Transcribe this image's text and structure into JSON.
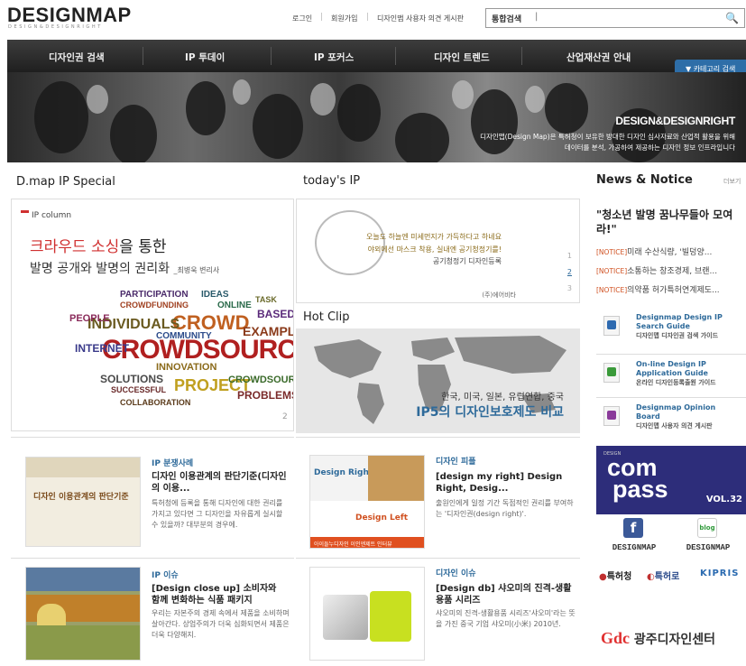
{
  "header": {
    "logo": "DESIGNMAP",
    "logo_sub": "DESIGN&DESIGNRIGHT",
    "links": [
      "로그인",
      "회원가입",
      "디자인맵 사용자 의견 게시판"
    ],
    "search_label": "통합검색",
    "search_caret": "|",
    "search_icon": "search-icon"
  },
  "nav": {
    "items": [
      "디자인권 검색",
      "IP 투데이",
      "IP 포커스",
      "디자인 트렌드",
      "산업재산권 안내"
    ],
    "category_button": "▼ 카테고리 검색"
  },
  "banner": {
    "title": "DESIGN&DESIGNRIGHT",
    "desc1": "디자인맵(Design Map)은 특허청이 보유한 방대한 디자인 심사자료와 산업적 활용을 위해",
    "desc2": "데이터를 분석, 가공하여 제공하는 디자인 정보 인프라입니다"
  },
  "ip_special": {
    "heading": "D.map IP Special",
    "column_label": "IP column",
    "headline_red": "크라우드 소싱",
    "headline_rest": "을 통한",
    "subheadline": "발명 공개와 발명의 권리화",
    "author": "_최병욱 변리사",
    "page": "2",
    "cloud_words": [
      "CROWDSOURCING",
      "CROWD",
      "INDIVIDUALS",
      "INTERNET",
      "PEOPLE",
      "EXAMPLE",
      "BASED",
      "ONLINE",
      "TASK",
      "COMMUNITY",
      "SOLUTIONS",
      "SUCCESSFUL",
      "PROJECT",
      "CROWDSOURCED",
      "COLLABORATION",
      "PROBLEMS",
      "PARTICIPATION",
      "CROWDFUNDING",
      "IDEAS",
      "INNOVATION"
    ]
  },
  "today_ip": {
    "heading": "today's IP",
    "line1": "오늘도 하늘엔 미세먼지가 가득하다고 하네요",
    "line2": "야외에선 마스크 착용, 실내엔 공기청정기를!",
    "line3": "공기청정기 디자인등록",
    "maker": "(주)에어비타",
    "pages": [
      "1",
      "2",
      "3"
    ]
  },
  "hot_clip": {
    "heading": "Hot Clip",
    "line1": "한국, 미국, 일본, 유럽연합, 중국",
    "line2": "IP5의 디자인보호제도 비교"
  },
  "news": {
    "heading": "News & Notice",
    "more": "더보기",
    "title": "\"청소년 발명 꿈나무들아 모여라!\"",
    "items": [
      {
        "tag": "[NOTICE]",
        "text": "미래 수산식량, '빌덩양..."
      },
      {
        "tag": "[NOTICE]",
        "text": "소통하는 창조경제, 브랜..."
      },
      {
        "tag": "[NOTICE]",
        "text": "의약품 허가특허연계제도..."
      }
    ]
  },
  "quick_links": [
    {
      "title": "Designmap Design IP Search Guide",
      "sub": "디자인맵 디자인권 검색 가이드",
      "icon": "search-guide-icon",
      "color": "#2e6ab0"
    },
    {
      "title": "On-line Design IP Application Guide",
      "sub": "온라인 디자인등록출원 가이드",
      "icon": "application-guide-icon",
      "color": "#3a9a3a"
    },
    {
      "title": "Designmap Opinion Board",
      "sub": "디자인맵 사용자 의견 게시판",
      "icon": "opinion-board-icon",
      "color": "#8a3a9a"
    }
  ],
  "compass": {
    "small": "DESIGN",
    "line1": "com",
    "line2": "pass",
    "vol": "VOL.32"
  },
  "social": [
    {
      "label": "DESIGNMAP",
      "icon": "facebook-icon",
      "color": "#3b5998"
    },
    {
      "label": "DESIGNMAP",
      "icon": "blog-icon",
      "color": "#2f9a3a"
    }
  ],
  "partner_logos": [
    "특허청",
    "특허로",
    "KIPRIS"
  ],
  "gdc": {
    "mark": "Gdc",
    "text": "광주디자인센터"
  },
  "articles": [
    {
      "cat": "IP 분쟁사례",
      "title": "디자인 이용관계의 판단기준(디자인의 이용...",
      "desc": "특허청에 등록을 통해 디자인에 대한 권리를 가지고 있다면 그 디자인을 자유롭게 실시할 수 있을까? 대부분의 경우에.",
      "thumb_text": "디자인 이용관계의 판단기준"
    },
    {
      "cat": "디자인 피플",
      "title": "[design my right] Design Right, Desig...",
      "desc": "출원인에게 일정 기간 독점적인 권리를 부여하는 '디자인권(design right)'.",
      "thumb_text": "아이들누디자인 이인엔제트 인터뷰",
      "thumb_text2": "Design Right",
      "thumb_text3": "Design Left"
    },
    {
      "cat": "IP 이슈",
      "title": "[Design close up] 소비자와 함께 변화하는 식품 패키지",
      "desc": "우리는 자본주의 경제 속에서 제품을 소비하며 살아간다. 상업주의가 더욱 심화되면서 제품은 더욱 다양해지.",
      "thumb_text": ""
    },
    {
      "cat": "디자인 이슈",
      "title": "[Design db] 샤오미의 진격-생활용품 시리즈",
      "desc": "샤오미의 진격-생활용품 시리즈'샤오미'라는 뜻을 가진 중국 기업 샤오미(小米) 2010년.",
      "thumb_text": ""
    }
  ]
}
